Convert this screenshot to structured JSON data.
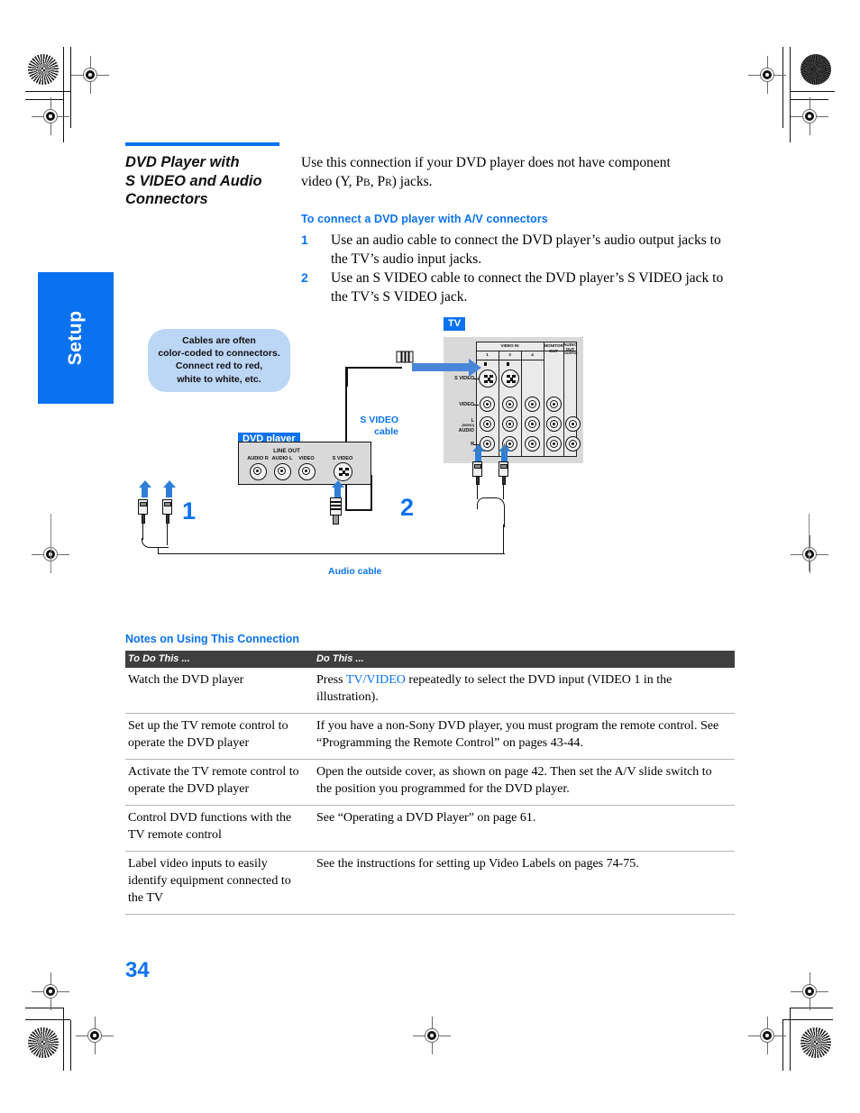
{
  "sidebar_tab": {
    "label": "Setup"
  },
  "section": {
    "title_line1": "DVD Player with",
    "title_line2": "S VIDEO and Audio",
    "title_line3": "Connectors",
    "accent_color": "#0a72f0"
  },
  "intro": {
    "line1": "Use this connection if your DVD player does not have component",
    "line2_pre": "video (Y, P",
    "line2_sub1": "B",
    "line2_mid": ", P",
    "line2_sub2": "R",
    "line2_post": ") jacks."
  },
  "subhead": "To connect a DVD player with A/V connectors",
  "steps": [
    {
      "num": "1",
      "text": "Use an audio cable to connect the DVD player’s audio output jacks to the TV’s audio input jacks."
    },
    {
      "num": "2",
      "text": "Use an S VIDEO cable to connect the DVD player’s S VIDEO jack to the TV’s S VIDEO jack."
    }
  ],
  "callout": {
    "line1": "Cables are often",
    "line2": "color-coded to connectors.",
    "line3": "Connect red to red,",
    "line4": "white to white, etc."
  },
  "diagram": {
    "tv_tag": "TV",
    "dvd_tag": "DVD player",
    "svideo_cable_label_line1": "S VIDEO",
    "svideo_cable_label_line2": "cable",
    "audio_cable_label": "Audio cable",
    "step_marker_1": "1",
    "step_marker_2": "2",
    "tv_panel": {
      "group_video_in": "VIDEO IN",
      "columns": [
        "1",
        "3",
        "4"
      ],
      "group_monitor_out_l1": "MONITOR",
      "group_monitor_out_l2": "OUT",
      "group_audio_out_l1": "AUDIO",
      "group_audio_out_l2": "OUT",
      "group_audio_out_l3": "(VAR/FIX)",
      "row_svideo": "S VIDEO",
      "row_video": "VIDEO",
      "row_audio_l": "L",
      "row_audio_mono": "(MONO)",
      "row_audio": "AUDIO",
      "row_audio_r": "R"
    },
    "dvd_panel": {
      "line_out": "LINE OUT",
      "audio_r": "AUDIO R",
      "audio_l": "AUDIO L",
      "video": "VIDEO",
      "svideo": "S VIDEO"
    }
  },
  "notes": {
    "heading": "Notes on Using This Connection",
    "columns": [
      "To Do This ...",
      "Do This ..."
    ],
    "rows": [
      {
        "todo": "Watch the DVD player",
        "do_pre": "Press ",
        "do_hl": "TV/VIDEO",
        "do_post": " repeatedly to select the DVD input (VIDEO 1 in the illustration)."
      },
      {
        "todo": "Set up the TV remote control to operate the DVD player",
        "do_pre": "If you have a non-Sony DVD player, you must program the remote control. See “Programming the Remote Control” on pages 43-44.",
        "do_hl": "",
        "do_post": ""
      },
      {
        "todo": "Activate the TV remote control to operate the DVD player",
        "do_pre": "Open the outside cover, as shown on page 42. Then set the A/V slide switch to the position you programmed for the DVD player.",
        "do_hl": "",
        "do_post": ""
      },
      {
        "todo": "Control DVD functions with the TV remote control",
        "do_pre": "See “Operating a DVD Player” on page 61.",
        "do_hl": "",
        "do_post": ""
      },
      {
        "todo": "Label video inputs to easily identify equipment connected to the TV",
        "do_pre": "See the instructions for setting up Video Labels on pages 74-75.",
        "do_hl": "",
        "do_post": ""
      }
    ]
  },
  "page_number": "34"
}
